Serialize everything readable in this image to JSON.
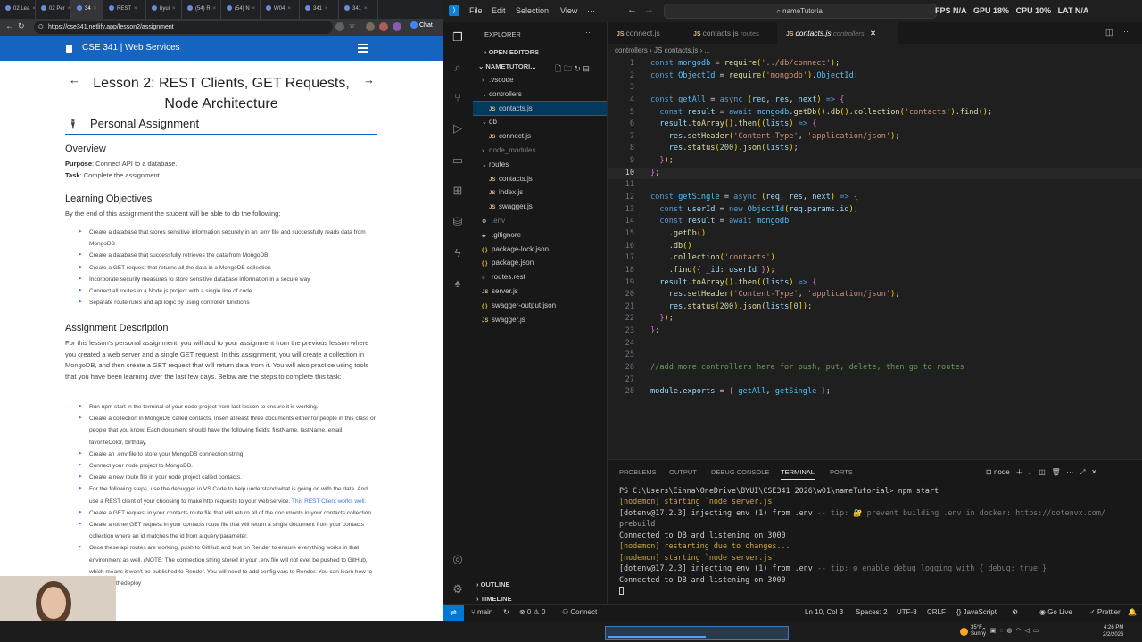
{
  "browser": {
    "tabs": [
      {
        "label": "02 Lea"
      },
      {
        "label": "02 Per"
      },
      {
        "label": "34"
      },
      {
        "label": "REST"
      },
      {
        "label": "byui"
      },
      {
        "label": "(54) R"
      },
      {
        "label": "(54) N"
      },
      {
        "label": "W04"
      },
      {
        "label": "341"
      },
      {
        "label": "341"
      }
    ],
    "url": "https://cse341.netlify.app/lesson2/assignment",
    "chat_label": "Chat"
  },
  "site": {
    "header_title": "CSE 341 | Web Services",
    "lesson_title": "Lesson 2: REST Clients, GET Requests, Node Architecture",
    "section_title": "Personal Assignment",
    "overview_heading": "Overview",
    "purpose_label": "Purpose",
    "purpose_text": ": Connect API to a database.",
    "task_label": "Task",
    "task_text": ": Complete the assignment.",
    "objectives_heading": "Learning Objectives",
    "objectives_intro": "By the end of this assignment the student will be able to do the following:",
    "objectives": [
      "Create a database that stores sensitive information securely in an .env file and successfully reads data from MongoDB",
      "Create a database that successfully retrieves the data from MongoDB",
      "Create a GET request that returns all the data in a MongoDB collection",
      "Incorporate security measures to store sensitive database information in a secure way",
      "Connect all routes in a Node.js project with a single line of code",
      "Separate route rules and api logic by using controller functions"
    ],
    "description_heading": "Assignment Description",
    "description_text": "For this lesson's personal assignment, you will add to your assignment from the previous lesson where you created a web server and a single GET request. In this assignment, you will create a collection in MongoDB, and then create a GET request that will return data from it. You will also practice using tools that you have been learning over the last few days. Below are the steps to complete this task:",
    "steps": [
      "Run npm start in the terminal of your node project from last lesson to ensure it is working.",
      "Create a collection in MongoDB called contacts. Insert at least three documents either for people in this class or people that you know. Each document should have the following fields: firstName, lastName, email, favoriteColor, birthday.",
      "Create an .env file to store your MongoDB connection string.",
      "Connect your node project to MongoDB.",
      "Create a new route file in your node project called contacts.",
      "For the following steps, use the debugger in VS Code to help understand what is going on with the data. And use a REST client of your choosing to make http requests to your web service.",
      "Create a GET request in your contacts route file that will return all of the documents in your contacts collection.",
      "Create another GET request in your contacts route file that will return a single document from your contacts collection where an id matches the id from a query parameter.",
      "Once these api routes are working, push to GitHub and test on Render to ensure everything works in that environment as well. (NOTE: The connection string stored in your .env file will not ever be pushed to GitHub, which means it won't be published to Render. You will need to add config vars to Render. You can learn how to do this on thedeploy"
    ],
    "rest_link_text": "This REST Client works well."
  },
  "vscode": {
    "menu": [
      "File",
      "Edit",
      "Selection",
      "View",
      "···"
    ],
    "search_text": "nameTutorial",
    "perf": {
      "fps": "FPS N/A",
      "gpu": "GPU 18%",
      "cpu": "CPU 10%",
      "lat": "LAT N/A"
    },
    "explorer_title": "EXPLORER",
    "open_editors": "OPEN EDITORS",
    "workspace": "NAMETUTORI...",
    "tree": [
      {
        "name": ".vscode",
        "type": "folder",
        "depth": 1,
        "open": false
      },
      {
        "name": "controllers",
        "type": "folder",
        "depth": 1,
        "open": true
      },
      {
        "name": "contacts.js",
        "type": "js",
        "depth": 2,
        "selected": true
      },
      {
        "name": "db",
        "type": "folder",
        "depth": 1,
        "open": true
      },
      {
        "name": "connect.js",
        "type": "js",
        "depth": 2
      },
      {
        "name": "node_modules",
        "type": "folder",
        "depth": 1,
        "open": false,
        "dim": true
      },
      {
        "name": "routes",
        "type": "folder",
        "depth": 1,
        "open": true
      },
      {
        "name": "contacts.js",
        "type": "js",
        "depth": 2
      },
      {
        "name": "index.js",
        "type": "js",
        "depth": 2
      },
      {
        "name": "swagger.js",
        "type": "js",
        "depth": 2
      },
      {
        "name": ".env",
        "type": "env",
        "depth": 1,
        "dim": true
      },
      {
        "name": ".gitignore",
        "type": "git",
        "depth": 1
      },
      {
        "name": "package-lock.json",
        "type": "json",
        "depth": 1
      },
      {
        "name": "package.json",
        "type": "json",
        "depth": 1
      },
      {
        "name": "routes.rest",
        "type": "rest",
        "depth": 1
      },
      {
        "name": "server.js",
        "type": "js",
        "depth": 1
      },
      {
        "name": "swagger-output.json",
        "type": "json",
        "depth": 1
      },
      {
        "name": "swagger.js",
        "type": "js",
        "depth": 1
      }
    ],
    "outline": "OUTLINE",
    "timeline": "TIMELINE",
    "tabs": [
      {
        "name": "connect.js",
        "path": "",
        "active": false
      },
      {
        "name": "contacts.js",
        "path": "routes",
        "active": false
      },
      {
        "name": "contacts.js",
        "path": "controllers",
        "active": true
      }
    ],
    "breadcrumb": "controllers  ›  JS contacts.js  ›  ...",
    "current_line": 10,
    "code_lines": [
      "const mongodb = require('../db/connect');",
      "const ObjectId = require('mongodb').ObjectId;",
      "",
      "const getAll = async (req, res, next) => {",
      "  const result = await mongodb.getDb().db().collection('contacts').find();",
      "  result.toArray().then((lists) => {",
      "    res.setHeader('Content-Type', 'application/json');",
      "    res.status(200).json(lists);",
      "  });",
      "};",
      "",
      "const getSingle = async (req, res, next) => {",
      "  const userId = new ObjectId(req.params.id);",
      "  const result = await mongodb",
      "    .getDb()",
      "    .db()",
      "    .collection('contacts')",
      "    .find({ _id: userId });",
      "  result.toArray().then((lists) => {",
      "    res.setHeader('Content-Type', 'application/json');",
      "    res.status(200).json(lists[0]);",
      "  });",
      "};",
      "",
      "",
      "//add more controllers here for push, put, delete, then go to routes",
      "",
      "module.exports = { getAll, getSingle };"
    ],
    "panel_tabs": [
      "PROBLEMS",
      "OUTPUT",
      "DEBUG CONSOLE",
      "TERMINAL",
      "PORTS"
    ],
    "terminal_name": "node",
    "terminal_lines": [
      "PS C:\\Users\\Einna\\OneDrive\\BYUI\\CSE341 2026\\w01\\nameTutorial> npm start",
      "[nodemon] starting `node server.js`",
      "[dotenv@17.2.3] injecting env (1) from .env -- tip: 🔐 prevent building .env in docker: https://dotenvx.com/",
      "prebuild",
      "Connected to DB and listening on 3000",
      "[nodemon] restarting due to changes...",
      "[nodemon] starting `node server.js`",
      "[dotenv@17.2.3] injecting env (1) from .env -- tip: ⚙ enable debug logging with { debug: true }",
      "Connected to DB and listening on 3000",
      ""
    ],
    "status": {
      "branch": "main",
      "problems": "⊗ 0 ⚠ 0",
      "connect": "Connect",
      "position": "Ln 10, Col 3",
      "spaces": "Spaces: 2",
      "encoding": "UTF-8",
      "eol": "CRLF",
      "language": "{} JavaScript",
      "golive": "Go Live",
      "prettier": "✓ Prettier"
    }
  },
  "taskbar": {
    "weather_temp": "35°F",
    "weather_desc": "Sunny",
    "time": "4:26 PM",
    "date": "2/2/2026"
  },
  "colors": {
    "site_header": "#1565c0",
    "vscode_accent": "#0078d4",
    "selection": "#04395e"
  }
}
